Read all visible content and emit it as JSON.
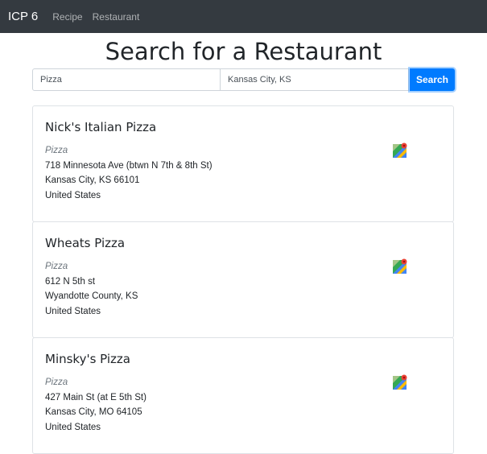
{
  "navbar": {
    "brand": "ICP 6",
    "links": [
      "Recipe",
      "Restaurant"
    ]
  },
  "page_title": "Search for a Restaurant",
  "search": {
    "term_value": "Pizza",
    "location_value": "Kansas City, KS",
    "button_label": "Search"
  },
  "results": [
    {
      "name": "Nick's Italian Pizza",
      "category": "Pizza",
      "address_lines": [
        "718 Minnesota Ave (btwn N 7th & 8th St)",
        "Kansas City, KS 66101",
        "United States"
      ]
    },
    {
      "name": "Wheats Pizza",
      "category": "Pizza",
      "address_lines": [
        "612 N 5th st",
        "Wyandotte County, KS",
        "United States"
      ]
    },
    {
      "name": "Minsky's Pizza",
      "category": "Pizza",
      "address_lines": [
        "427 Main St (at E 5th St)",
        "Kansas City, MO 64105",
        "United States"
      ]
    }
  ],
  "icons": {
    "map": "google-maps-icon"
  },
  "colors": {
    "navbar": "#343a40",
    "primary": "#007bff"
  }
}
